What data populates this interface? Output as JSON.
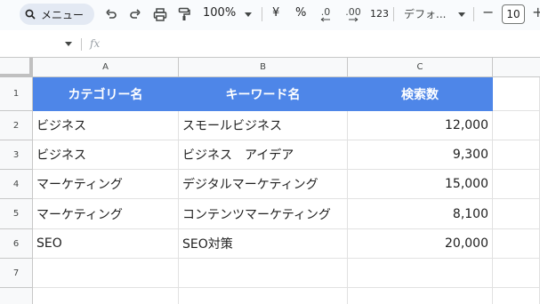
{
  "toolbar": {
    "search_label": "メニュー",
    "zoom": "100%",
    "currency": "¥",
    "percent": "%",
    "decrease_decimal": ".0",
    "increase_decimal": ".00",
    "number_format": "123",
    "font_name": "デフォ...",
    "font_size": "10",
    "minus": "−",
    "plus": "+"
  },
  "formula_bar": {
    "fx": "fx"
  },
  "columns": [
    "A",
    "B",
    "C"
  ],
  "rows": [
    "1",
    "2",
    "3",
    "4",
    "5",
    "6",
    "7"
  ],
  "header_row": [
    "カテゴリー名",
    "キーワード名",
    "検索数"
  ],
  "data_rows": [
    [
      "ビジネス",
      "スモールビジネス",
      "12,000"
    ],
    [
      "ビジネス",
      "ビジネス　アイデア",
      "9,300"
    ],
    [
      "マーケティング",
      "デジタルマーケティング",
      "15,000"
    ],
    [
      "マーケティング",
      "コンテンツマーケティング",
      "8,100"
    ],
    [
      "SEO",
      "SEO対策",
      "20,000"
    ],
    [
      "",
      "",
      ""
    ]
  ],
  "colors": {
    "header_fill": "#4e86e8",
    "header_text": "#ffffff"
  }
}
